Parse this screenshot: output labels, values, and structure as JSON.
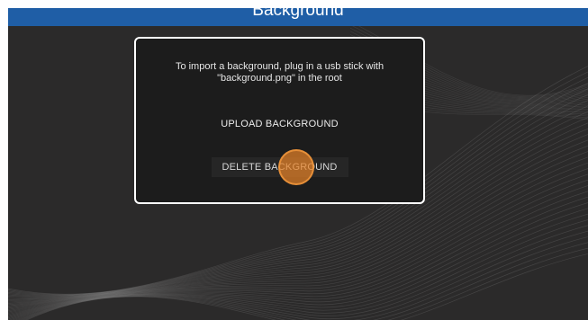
{
  "header": {
    "title": "Background"
  },
  "dialog": {
    "message": "To import a background, plug in a usb stick with\n\"background.png\" in the root",
    "upload_label": "UPLOAD BACKGROUND",
    "delete_label": "DELETE BACKGROUND"
  },
  "colors": {
    "header": "#1f5ea6",
    "background": "#2b2a2a",
    "dialog": "#1c1c1c",
    "touch_indicator": "#e6822a"
  }
}
